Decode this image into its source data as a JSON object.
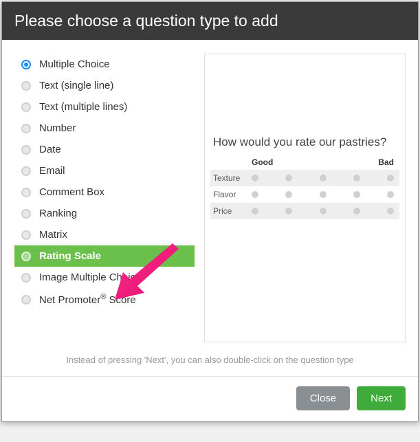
{
  "header": {
    "title": "Please choose a question type to add"
  },
  "qtypes": [
    {
      "label": "Multiple Choice",
      "selected": true
    },
    {
      "label": "Text (single line)"
    },
    {
      "label": "Text (multiple lines)"
    },
    {
      "label": "Number"
    },
    {
      "label": "Date"
    },
    {
      "label": "Email"
    },
    {
      "label": "Comment Box"
    },
    {
      "label": "Ranking"
    },
    {
      "label": "Matrix"
    },
    {
      "label": "Rating Scale",
      "highlighted": true
    },
    {
      "label": "Image Multiple Choice"
    },
    {
      "label": "Net Promoter® Score"
    }
  ],
  "preview": {
    "question": "How would you rate our pastries?",
    "scale_left": "Good",
    "scale_right": "Bad",
    "rows": [
      "Texture",
      "Flavor",
      "Price"
    ]
  },
  "hint": "Instead of pressing 'Next', you can also double-click on the question type",
  "footer": {
    "close": "Close",
    "next": "Next"
  }
}
